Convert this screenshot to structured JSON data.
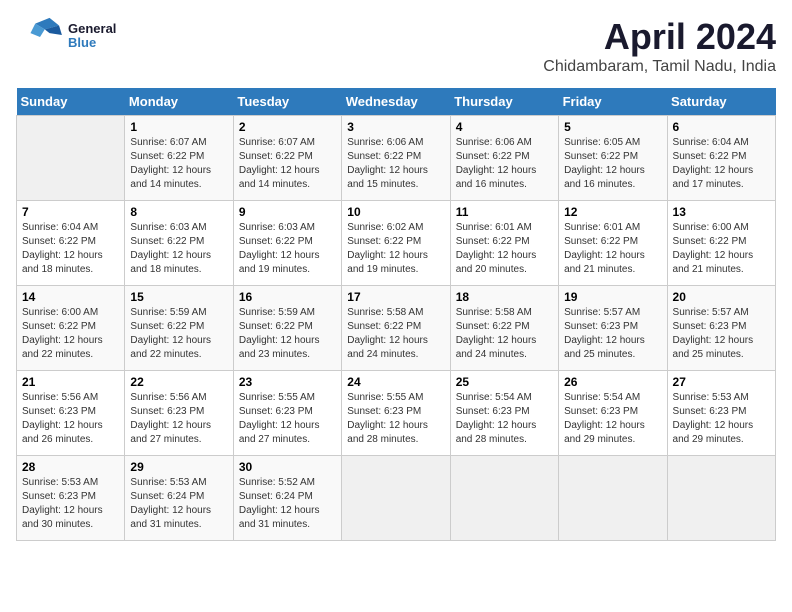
{
  "header": {
    "logo_line1": "General",
    "logo_line2": "Blue",
    "title": "April 2024",
    "subtitle": "Chidambaram, Tamil Nadu, India"
  },
  "calendar": {
    "days_of_week": [
      "Sunday",
      "Monday",
      "Tuesday",
      "Wednesday",
      "Thursday",
      "Friday",
      "Saturday"
    ],
    "weeks": [
      [
        {
          "day": "",
          "sunrise": "",
          "sunset": "",
          "daylight": ""
        },
        {
          "day": "1",
          "sunrise": "Sunrise: 6:07 AM",
          "sunset": "Sunset: 6:22 PM",
          "daylight": "Daylight: 12 hours and 14 minutes."
        },
        {
          "day": "2",
          "sunrise": "Sunrise: 6:07 AM",
          "sunset": "Sunset: 6:22 PM",
          "daylight": "Daylight: 12 hours and 14 minutes."
        },
        {
          "day": "3",
          "sunrise": "Sunrise: 6:06 AM",
          "sunset": "Sunset: 6:22 PM",
          "daylight": "Daylight: 12 hours and 15 minutes."
        },
        {
          "day": "4",
          "sunrise": "Sunrise: 6:06 AM",
          "sunset": "Sunset: 6:22 PM",
          "daylight": "Daylight: 12 hours and 16 minutes."
        },
        {
          "day": "5",
          "sunrise": "Sunrise: 6:05 AM",
          "sunset": "Sunset: 6:22 PM",
          "daylight": "Daylight: 12 hours and 16 minutes."
        },
        {
          "day": "6",
          "sunrise": "Sunrise: 6:04 AM",
          "sunset": "Sunset: 6:22 PM",
          "daylight": "Daylight: 12 hours and 17 minutes."
        }
      ],
      [
        {
          "day": "7",
          "sunrise": "Sunrise: 6:04 AM",
          "sunset": "Sunset: 6:22 PM",
          "daylight": "Daylight: 12 hours and 18 minutes."
        },
        {
          "day": "8",
          "sunrise": "Sunrise: 6:03 AM",
          "sunset": "Sunset: 6:22 PM",
          "daylight": "Daylight: 12 hours and 18 minutes."
        },
        {
          "day": "9",
          "sunrise": "Sunrise: 6:03 AM",
          "sunset": "Sunset: 6:22 PM",
          "daylight": "Daylight: 12 hours and 19 minutes."
        },
        {
          "day": "10",
          "sunrise": "Sunrise: 6:02 AM",
          "sunset": "Sunset: 6:22 PM",
          "daylight": "Daylight: 12 hours and 19 minutes."
        },
        {
          "day": "11",
          "sunrise": "Sunrise: 6:01 AM",
          "sunset": "Sunset: 6:22 PM",
          "daylight": "Daylight: 12 hours and 20 minutes."
        },
        {
          "day": "12",
          "sunrise": "Sunrise: 6:01 AM",
          "sunset": "Sunset: 6:22 PM",
          "daylight": "Daylight: 12 hours and 21 minutes."
        },
        {
          "day": "13",
          "sunrise": "Sunrise: 6:00 AM",
          "sunset": "Sunset: 6:22 PM",
          "daylight": "Daylight: 12 hours and 21 minutes."
        }
      ],
      [
        {
          "day": "14",
          "sunrise": "Sunrise: 6:00 AM",
          "sunset": "Sunset: 6:22 PM",
          "daylight": "Daylight: 12 hours and 22 minutes."
        },
        {
          "day": "15",
          "sunrise": "Sunrise: 5:59 AM",
          "sunset": "Sunset: 6:22 PM",
          "daylight": "Daylight: 12 hours and 22 minutes."
        },
        {
          "day": "16",
          "sunrise": "Sunrise: 5:59 AM",
          "sunset": "Sunset: 6:22 PM",
          "daylight": "Daylight: 12 hours and 23 minutes."
        },
        {
          "day": "17",
          "sunrise": "Sunrise: 5:58 AM",
          "sunset": "Sunset: 6:22 PM",
          "daylight": "Daylight: 12 hours and 24 minutes."
        },
        {
          "day": "18",
          "sunrise": "Sunrise: 5:58 AM",
          "sunset": "Sunset: 6:22 PM",
          "daylight": "Daylight: 12 hours and 24 minutes."
        },
        {
          "day": "19",
          "sunrise": "Sunrise: 5:57 AM",
          "sunset": "Sunset: 6:23 PM",
          "daylight": "Daylight: 12 hours and 25 minutes."
        },
        {
          "day": "20",
          "sunrise": "Sunrise: 5:57 AM",
          "sunset": "Sunset: 6:23 PM",
          "daylight": "Daylight: 12 hours and 25 minutes."
        }
      ],
      [
        {
          "day": "21",
          "sunrise": "Sunrise: 5:56 AM",
          "sunset": "Sunset: 6:23 PM",
          "daylight": "Daylight: 12 hours and 26 minutes."
        },
        {
          "day": "22",
          "sunrise": "Sunrise: 5:56 AM",
          "sunset": "Sunset: 6:23 PM",
          "daylight": "Daylight: 12 hours and 27 minutes."
        },
        {
          "day": "23",
          "sunrise": "Sunrise: 5:55 AM",
          "sunset": "Sunset: 6:23 PM",
          "daylight": "Daylight: 12 hours and 27 minutes."
        },
        {
          "day": "24",
          "sunrise": "Sunrise: 5:55 AM",
          "sunset": "Sunset: 6:23 PM",
          "daylight": "Daylight: 12 hours and 28 minutes."
        },
        {
          "day": "25",
          "sunrise": "Sunrise: 5:54 AM",
          "sunset": "Sunset: 6:23 PM",
          "daylight": "Daylight: 12 hours and 28 minutes."
        },
        {
          "day": "26",
          "sunrise": "Sunrise: 5:54 AM",
          "sunset": "Sunset: 6:23 PM",
          "daylight": "Daylight: 12 hours and 29 minutes."
        },
        {
          "day": "27",
          "sunrise": "Sunrise: 5:53 AM",
          "sunset": "Sunset: 6:23 PM",
          "daylight": "Daylight: 12 hours and 29 minutes."
        }
      ],
      [
        {
          "day": "28",
          "sunrise": "Sunrise: 5:53 AM",
          "sunset": "Sunset: 6:23 PM",
          "daylight": "Daylight: 12 hours and 30 minutes."
        },
        {
          "day": "29",
          "sunrise": "Sunrise: 5:53 AM",
          "sunset": "Sunset: 6:24 PM",
          "daylight": "Daylight: 12 hours and 31 minutes."
        },
        {
          "day": "30",
          "sunrise": "Sunrise: 5:52 AM",
          "sunset": "Sunset: 6:24 PM",
          "daylight": "Daylight: 12 hours and 31 minutes."
        },
        {
          "day": "",
          "sunrise": "",
          "sunset": "",
          "daylight": ""
        },
        {
          "day": "",
          "sunrise": "",
          "sunset": "",
          "daylight": ""
        },
        {
          "day": "",
          "sunrise": "",
          "sunset": "",
          "daylight": ""
        },
        {
          "day": "",
          "sunrise": "",
          "sunset": "",
          "daylight": ""
        }
      ]
    ]
  }
}
